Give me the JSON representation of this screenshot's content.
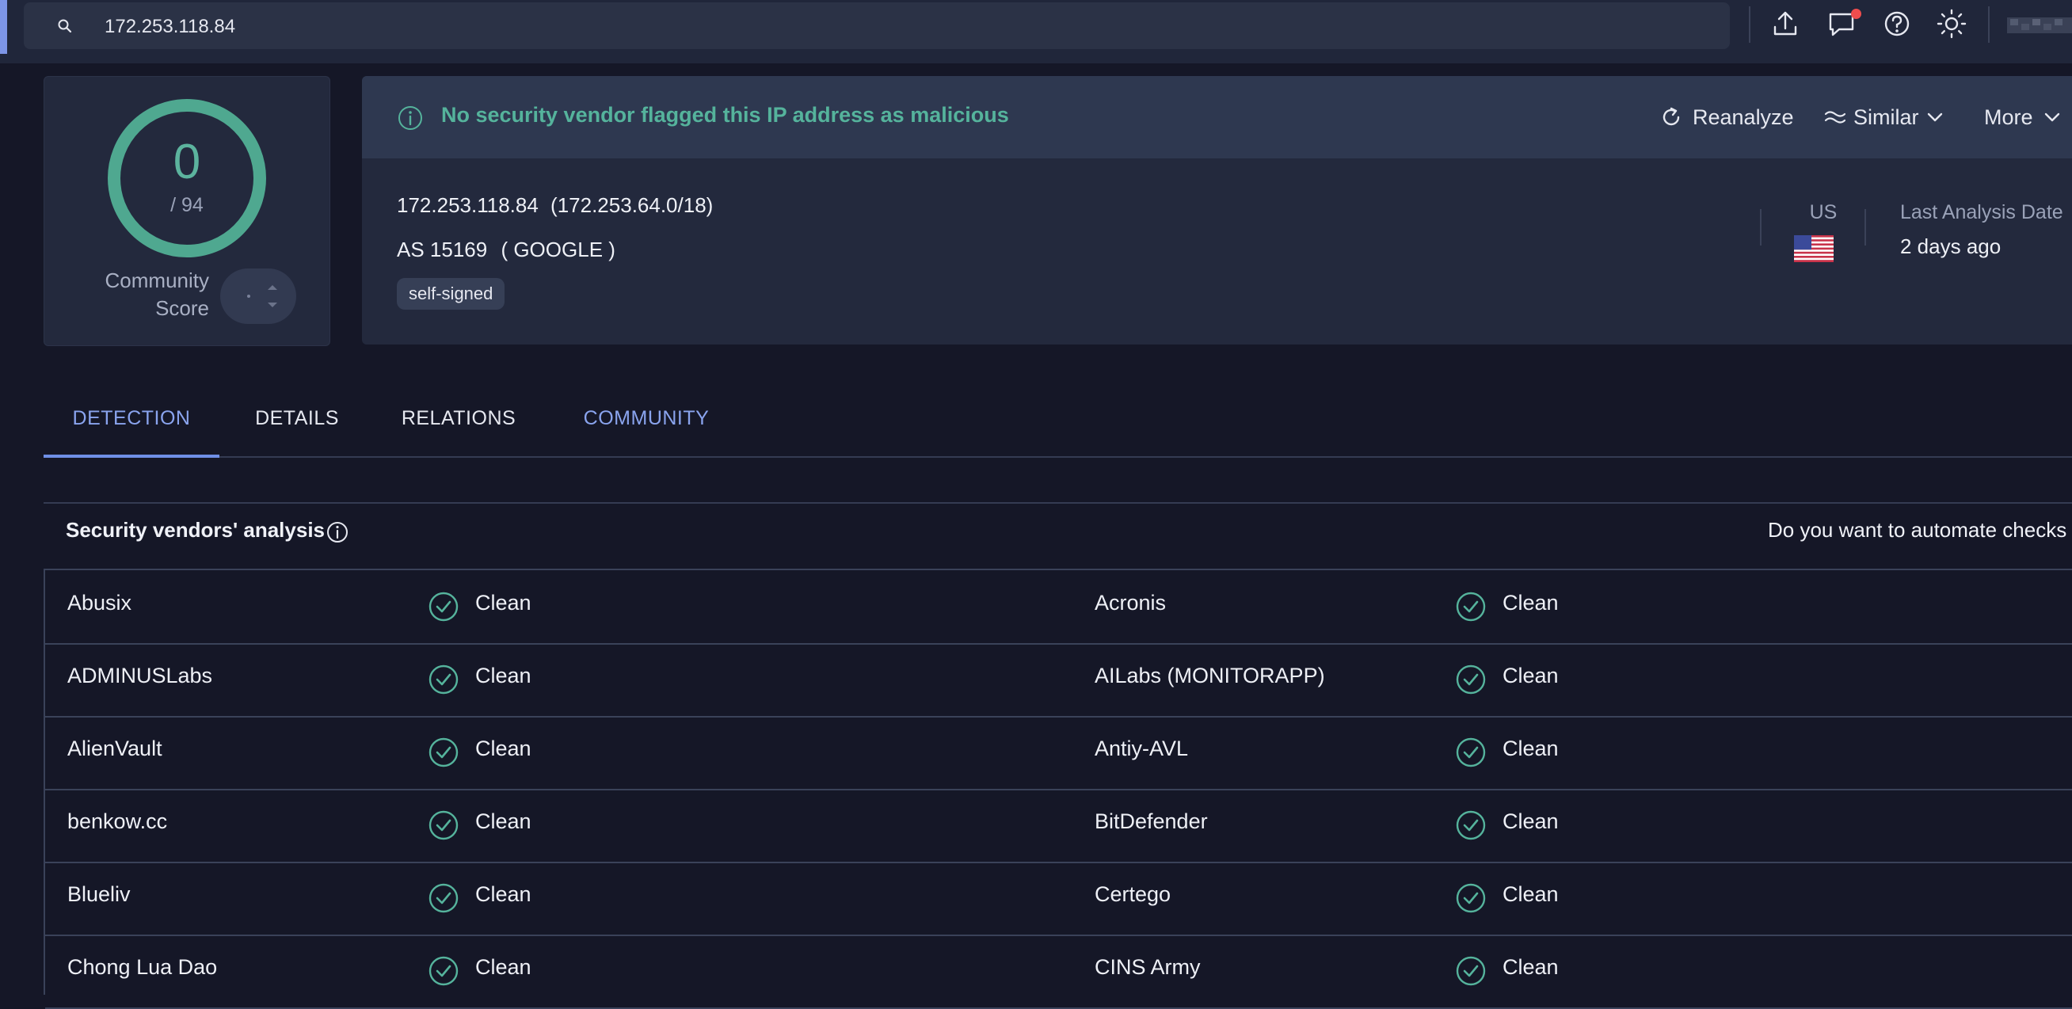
{
  "search": {
    "value": "172.253.118.84"
  },
  "score": {
    "detections": "0",
    "total": "/ 94",
    "community_label_line1": "Community",
    "community_label_line2": "Score"
  },
  "banner": {
    "text": "No security vendor flagged this IP address as malicious"
  },
  "actions": {
    "reanalyze": "Reanalyze",
    "similar": "Similar",
    "more": "More"
  },
  "ip_info": {
    "ip": "172.253.118.84",
    "network": "(172.253.64.0/18)",
    "as_number": "AS 15169",
    "as_owner": "( GOOGLE )",
    "tag": "self-signed",
    "country": "US",
    "last_analysis_label": "Last Analysis Date",
    "last_analysis_value": "2 days ago"
  },
  "tabs": [
    {
      "label": "DETECTION"
    },
    {
      "label": "DETAILS"
    },
    {
      "label": "RELATIONS"
    },
    {
      "label": "COMMUNITY"
    }
  ],
  "vendors_section": {
    "title": "Security vendors' analysis",
    "automate": "Do you want to automate checks"
  },
  "vendors": [
    {
      "left_name": "Abusix",
      "left_result": "Clean",
      "right_name": "Acronis",
      "right_result": "Clean"
    },
    {
      "left_name": "ADMINUSLabs",
      "left_result": "Clean",
      "right_name": "AILabs (MONITORAPP)",
      "right_result": "Clean"
    },
    {
      "left_name": "AlienVault",
      "left_result": "Clean",
      "right_name": "Antiy-AVL",
      "right_result": "Clean"
    },
    {
      "left_name": "benkow.cc",
      "left_result": "Clean",
      "right_name": "BitDefender",
      "right_result": "Clean"
    },
    {
      "left_name": "Blueliv",
      "left_result": "Clean",
      "right_name": "Certego",
      "right_result": "Clean"
    },
    {
      "left_name": "Chong Lua Dao",
      "left_result": "Clean",
      "right_name": "CINS Army",
      "right_result": "Clean"
    }
  ],
  "colors": {
    "clean_green": "#55b39c",
    "accent_blue": "#8aa4ee",
    "notification_red": "#f04d4d"
  }
}
